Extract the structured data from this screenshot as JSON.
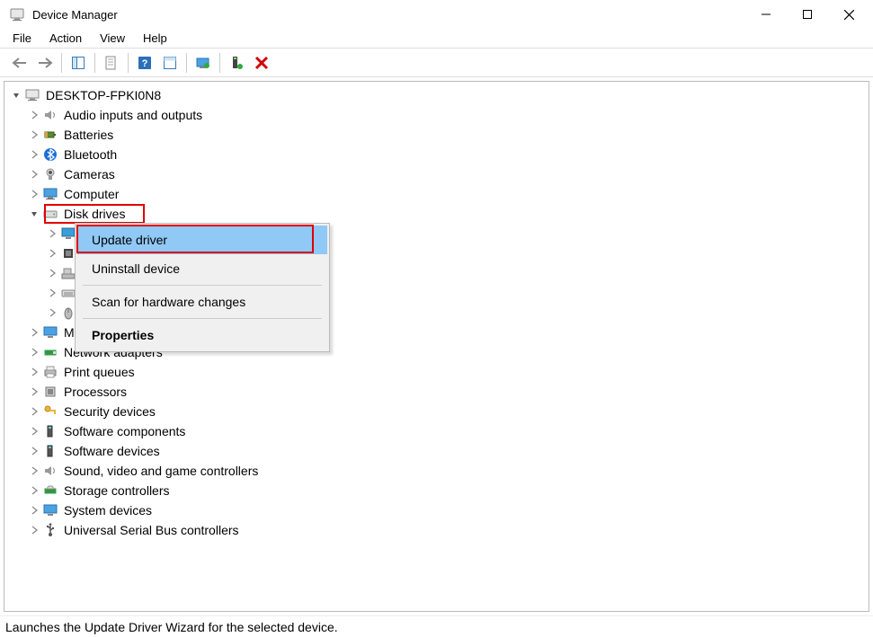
{
  "window": {
    "title": "Device Manager"
  },
  "menu": {
    "file": "File",
    "action": "Action",
    "view": "View",
    "help": "Help"
  },
  "tree": {
    "root": "DESKTOP-FPKI0N8",
    "items": [
      "Audio inputs and outputs",
      "Batteries",
      "Bluetooth",
      "Cameras",
      "Computer",
      "Disk drives",
      "Monitors",
      "Network adapters",
      "Print queues",
      "Processors",
      "Security devices",
      "Software components",
      "Software devices",
      "Sound, video and game controllers",
      "Storage controllers",
      "System devices",
      "Universal Serial Bus controllers"
    ]
  },
  "context_menu": {
    "update_driver": "Update driver",
    "uninstall_device": "Uninstall device",
    "scan": "Scan for hardware changes",
    "properties": "Properties"
  },
  "statusbar": {
    "text": "Launches the Update Driver Wizard for the selected device."
  }
}
